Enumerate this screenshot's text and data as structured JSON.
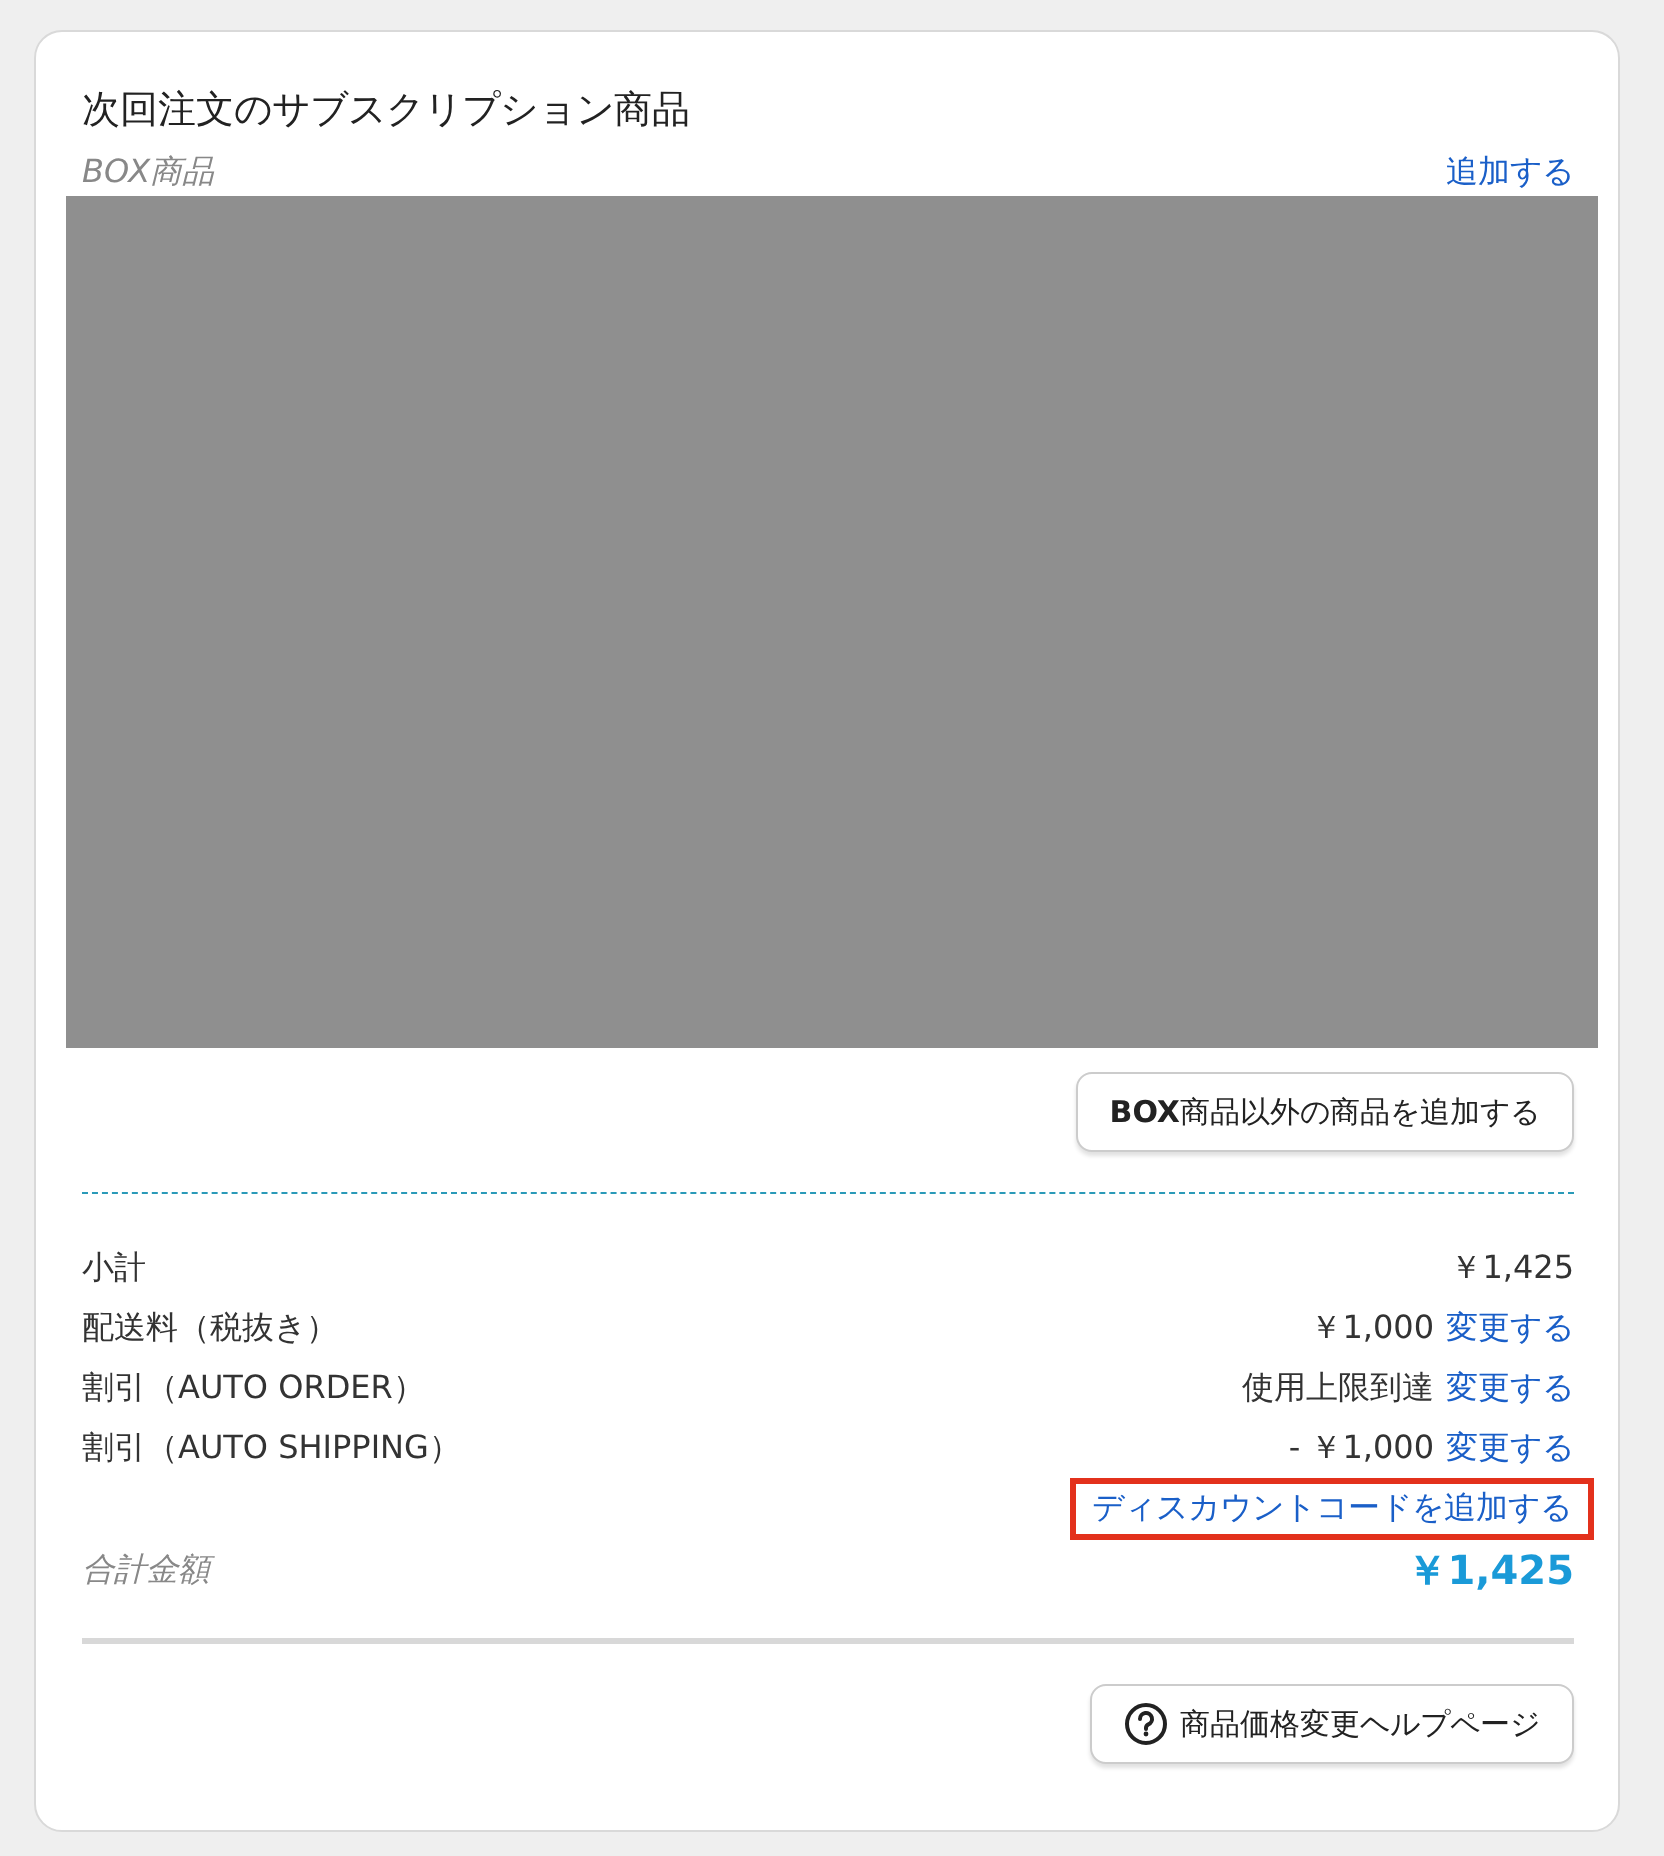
{
  "card": {
    "title": "次回注文のサブスクリプション商品",
    "section_label": "BOX商品",
    "add_link": "追加する",
    "media": {
      "kind": "redacted"
    },
    "add_other_button": "**BOX**商品以外の商品を追加する",
    "summary": [
      {
        "label": "小計",
        "value": "￥1,425"
      },
      {
        "label": "配送料（税抜き）",
        "value": "￥1,000",
        "link": "変更する"
      },
      {
        "label": "割引（AUTO ORDER）",
        "value": "使用上限到達",
        "link": "変更する"
      },
      {
        "label": "割引（AUTO SHIPPING）",
        "value": "- ￥1,000",
        "link": "変更する"
      }
    ],
    "discount_link": {
      "label": "ディスカウントコードを追加する",
      "highlighted": true
    },
    "total": {
      "label": "合計金額",
      "value": "￥1,425"
    },
    "help_button": "商品価格変更ヘルプページ"
  }
}
